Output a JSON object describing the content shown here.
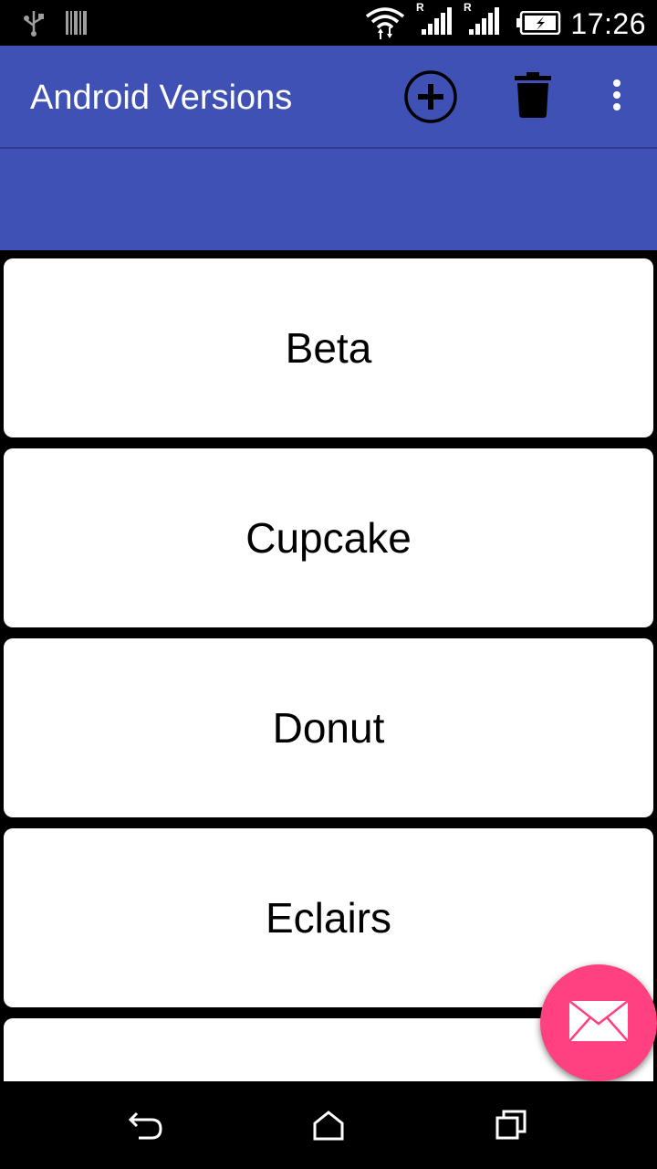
{
  "status_bar": {
    "time": "17:26",
    "icons": [
      "usb-icon",
      "barcode-icon",
      "wifi-icon",
      "signal-icon",
      "signal-icon",
      "battery-charging-icon"
    ],
    "roaming_label": "R"
  },
  "app_bar": {
    "title": "Android Versions",
    "actions": [
      "add-circle-icon",
      "delete-icon",
      "overflow-menu-icon"
    ],
    "color": "#3f51b5"
  },
  "list": {
    "items": [
      {
        "label": "Beta"
      },
      {
        "label": "Cupcake"
      },
      {
        "label": "Donut"
      },
      {
        "label": "Eclairs"
      },
      {
        "label": ""
      }
    ]
  },
  "fab": {
    "icon": "mail-icon",
    "color": "#ff4081"
  },
  "nav_bar": {
    "icons": [
      "back-icon",
      "home-icon",
      "recents-icon"
    ]
  }
}
